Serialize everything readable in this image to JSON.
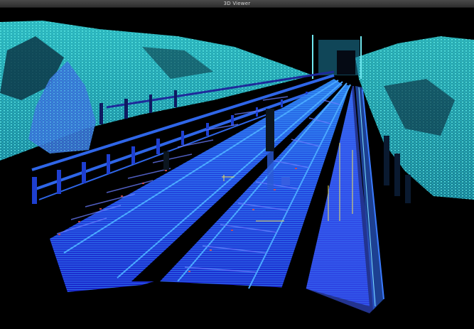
{
  "window": {
    "title": "3D Viewer"
  },
  "viewport": {
    "background_color": "#000000",
    "colors": {
      "near": "#1a2bd6",
      "mid": "#2e6bff",
      "far": "#36e0e6",
      "highlight": "#f0e35a",
      "accent_red": "#d83a3a"
    }
  }
}
